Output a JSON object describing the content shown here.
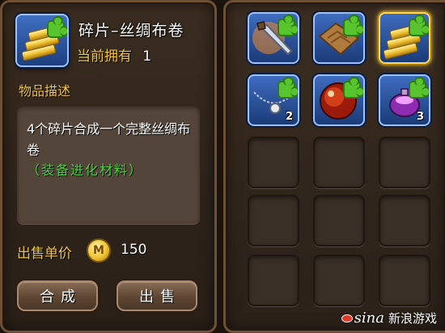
{
  "item": {
    "name": "碎片–丝绸布卷",
    "owned_label": "当前拥有",
    "owned_value": "1",
    "icon": "silk-roll-fragment-icon"
  },
  "description": {
    "heading": "物品描述",
    "text": "4个碎片合成一个完整丝绸布卷",
    "note": "（装备进化材料）"
  },
  "price": {
    "label": "出售单价",
    "currency_icon": "gold-coin-icon",
    "currency_letter": "M",
    "value": "150"
  },
  "buttons": {
    "combine": "合成",
    "sell": "出售"
  },
  "inventory": {
    "slots": [
      {
        "icon": "dagger-fragment-icon",
        "count": ""
      },
      {
        "icon": "leather-scroll-fragment-icon",
        "count": ""
      },
      {
        "icon": "silk-roll-fragment-icon",
        "count": "",
        "selected": true
      },
      {
        "icon": "necklace-fragment-icon",
        "count": "2"
      },
      {
        "icon": "red-orb-fragment-icon",
        "count": ""
      },
      {
        "icon": "purple-potion-fragment-icon",
        "count": "3"
      }
    ]
  },
  "watermark": {
    "logo": "sina",
    "text": "新浪游戏"
  },
  "colors": {
    "gold_text": "#f1c347",
    "green_note": "#49d43b",
    "fragment_green": "#58c52e",
    "slot_blue": "#3e6cc0"
  }
}
